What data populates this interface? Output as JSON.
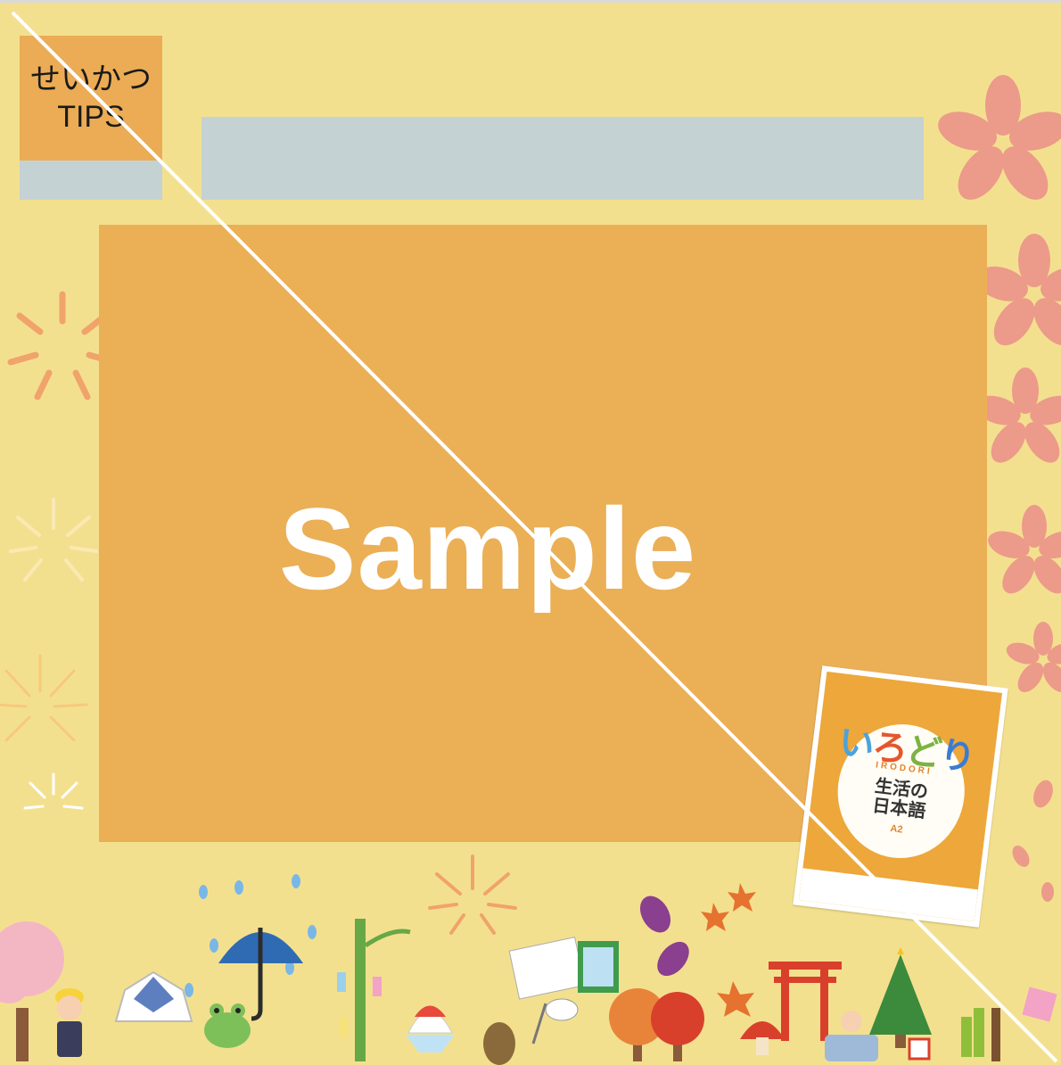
{
  "tips": {
    "line1": "せいかつ",
    "line2": "TIPS"
  },
  "watermark": "Sample",
  "book": {
    "title_chars": [
      "い",
      "ろ",
      "ど",
      "り"
    ],
    "title_colors": [
      "#4aa3df",
      "#e4572e",
      "#7cb342",
      "#3a7bd5"
    ],
    "romaji": "IRODORI",
    "subtitle": "生活の日本語",
    "level": "A2"
  },
  "colors": {
    "background": "#f3e08f",
    "panel": "#ebaf56",
    "placeholder": "#c5d2d4",
    "sakura": "#ec9a8a"
  },
  "decorations": [
    "sakura-flower-icon",
    "firework-icon",
    "raindrop-icon",
    "umbrella-icon",
    "frog-icon",
    "tanabata-bamboo-icon",
    "shaved-ice-icon",
    "cicada-icon",
    "bug-net-icon",
    "sweet-potato-icon",
    "maple-leaf-icon",
    "autumn-tree-icon",
    "torii-gate-icon",
    "mushroom-icon",
    "christmas-tree-icon",
    "gift-icon",
    "kadomatsu-icon",
    "paper-helmet-icon",
    "schoolchild-icon",
    "cherry-tree-icon"
  ]
}
